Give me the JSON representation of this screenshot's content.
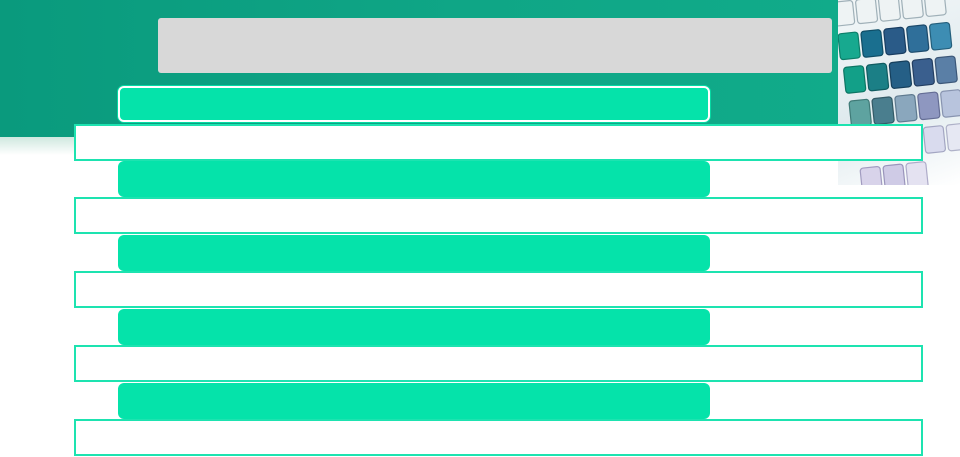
{
  "title": "",
  "sections": [
    {
      "heading": "",
      "body": ""
    },
    {
      "heading": "",
      "body": ""
    },
    {
      "heading": "",
      "body": ""
    },
    {
      "heading": "",
      "body": ""
    },
    {
      "heading": "",
      "body": ""
    }
  ],
  "colors": {
    "header_band": "#0fa686",
    "title_bar": "#d8d8d8",
    "heading_bar": "#05e3aa",
    "row_border": "#1de3b0",
    "background": "#ffffff"
  },
  "decorative_image": "keyboard-keys-photo"
}
